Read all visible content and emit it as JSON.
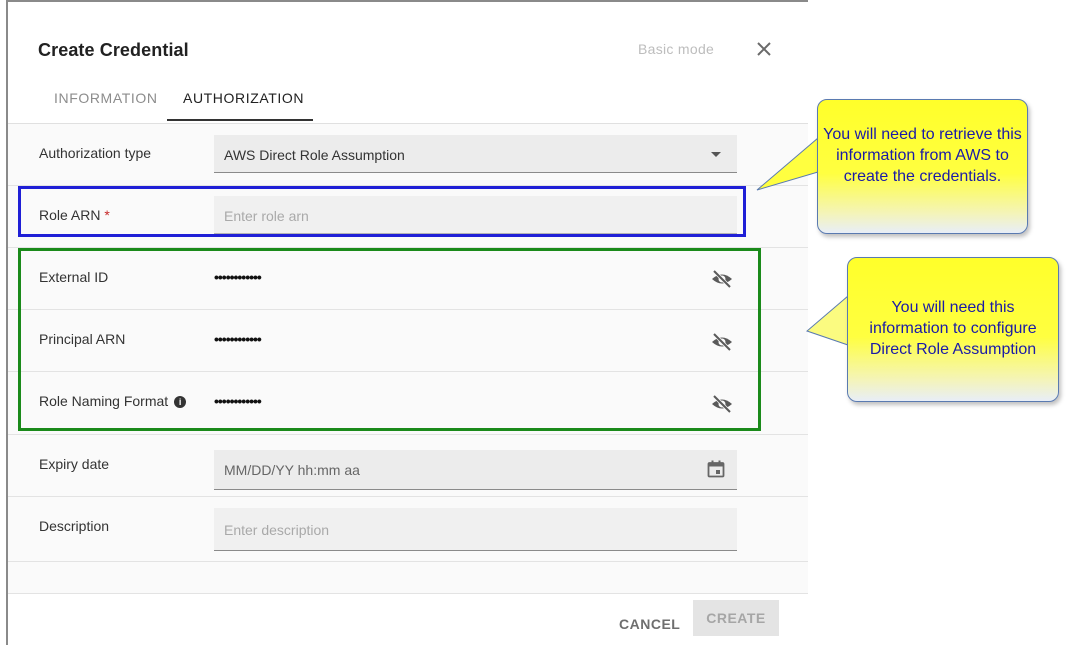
{
  "dialog": {
    "title": "Create Credential",
    "basic_mode": "Basic mode",
    "tabs": [
      {
        "label": "INFORMATION",
        "active": false
      },
      {
        "label": "AUTHORIZATION",
        "active": true
      }
    ]
  },
  "form": {
    "authorization_type": {
      "label": "Authorization type",
      "value": "AWS Direct Role Assumption"
    },
    "role_arn": {
      "label": "Role ARN",
      "required_mark": "*",
      "placeholder": "Enter role arn"
    },
    "external_id": {
      "label": "External ID",
      "value": "••••••••••••"
    },
    "principal_arn": {
      "label": "Principal ARN",
      "value": "••••••••••••"
    },
    "role_naming_format": {
      "label": "Role Naming Format",
      "info_icon": "i",
      "value": "••••••••••••"
    },
    "expiry_date": {
      "label": "Expiry date",
      "placeholder": "MM/DD/YY hh:mm aa"
    },
    "description": {
      "label": "Description",
      "placeholder": "Enter description"
    }
  },
  "footer": {
    "cancel_label": "CANCEL",
    "create_label": "CREATE"
  },
  "callouts": {
    "role_arn_note": "You will need to retrieve this information from AWS to create the credentials.",
    "direct_role_note": "You will need this information to configure Direct Role Assumption"
  },
  "colors": {
    "blue_box": "#1f1fd6",
    "green_box": "#1a8a1a",
    "callout_fill": "#ffff2a",
    "callout_text": "#1a1aa8"
  }
}
